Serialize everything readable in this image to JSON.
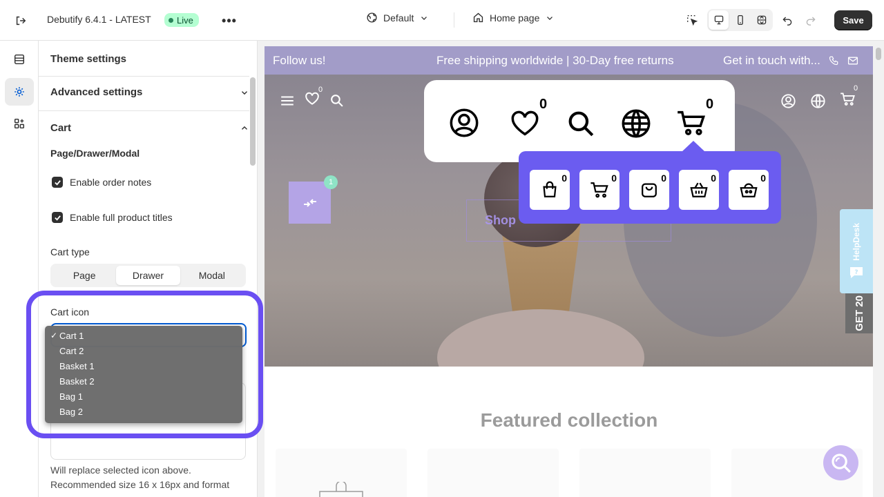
{
  "topbar": {
    "theme_name": "Debutify 6.4.1 - LATEST",
    "live_badge": "Live",
    "more_label": "•••",
    "theme_selector": "Default",
    "page_selector": "Home page",
    "save_label": "Save"
  },
  "panel": {
    "title": "Theme settings",
    "advanced_section": "Advanced settings",
    "cart_section": "Cart",
    "subsection": "Page/Drawer/Modal",
    "enable_order_notes": "Enable order notes",
    "enable_full_titles": "Enable full product titles",
    "cart_type_label": "Cart type",
    "cart_type_options": [
      "Page",
      "Drawer",
      "Modal"
    ],
    "cart_type_selected": "Drawer",
    "cart_icon_label": "Cart icon",
    "cart_icon_options": [
      "Cart 1",
      "Cart 2",
      "Basket 1",
      "Basket 2",
      "Bag 1",
      "Bag 2"
    ],
    "cart_icon_selected": "Cart 1",
    "help_text_1": "Will replace selected icon above.",
    "help_text_2": "Recommended size 16 x 16px and format"
  },
  "preview": {
    "announcement_left": "Follow us!",
    "announcement_mid": "Free shipping worldwide | 30-Day free returns",
    "announcement_right": "Get in touch with...",
    "wishlist_count": "0",
    "cart_count_small": "0",
    "big_wishlist_count": "0",
    "big_cart_count": "0",
    "mini_tiles": [
      {
        "icon": "bag-icon",
        "count": "0"
      },
      {
        "icon": "cart-icon",
        "count": "0"
      },
      {
        "icon": "bag-2-icon",
        "count": "0"
      },
      {
        "icon": "basket-icon",
        "count": "0"
      },
      {
        "icon": "basket-2-icon",
        "count": "0"
      }
    ],
    "compare_count": "1",
    "shop_button": "Shop",
    "featured_title": "Featured collection",
    "helpdesk_label": "HelpDesk",
    "promo_label": "GET 20"
  },
  "colors": {
    "accent": "#6b5cf0",
    "ring": "#6a4ff2",
    "announcement": "#a29cc8",
    "live_bg": "#b4fed2",
    "save_bg": "#303030"
  }
}
